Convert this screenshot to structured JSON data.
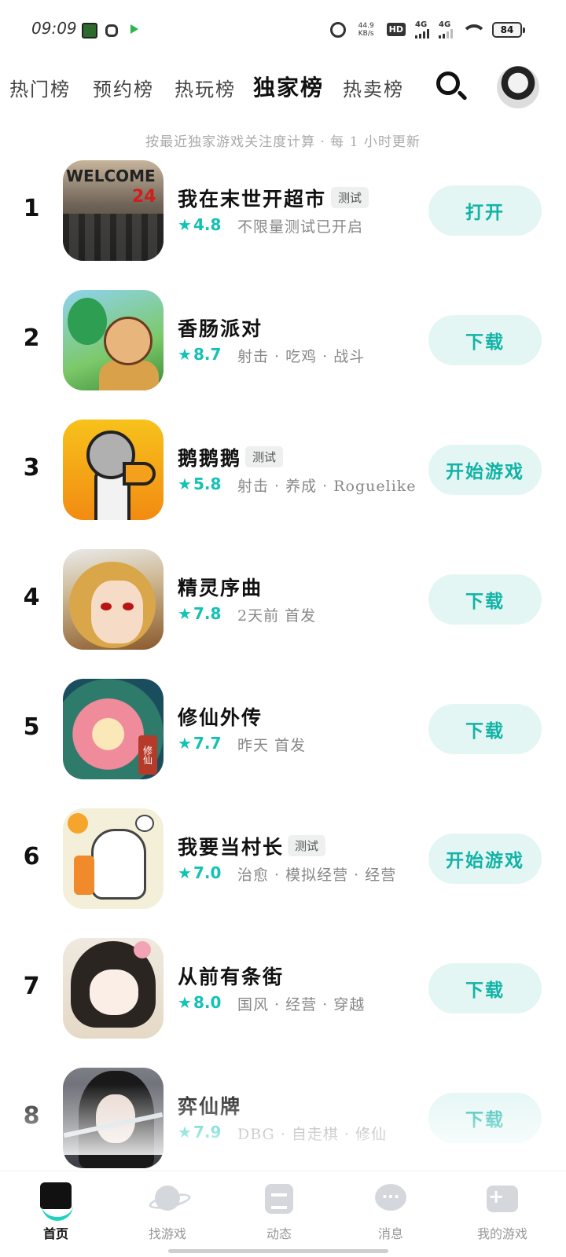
{
  "status_bar": {
    "time": "09:09",
    "net_speed_value": "44.9",
    "net_speed_unit": "KB/s",
    "hd_label": "HD",
    "sim1": "4G",
    "sim2": "4G",
    "battery": "84",
    "icons": [
      "app-icon-green",
      "app-icon-flower",
      "app-icon-play",
      "alarm-icon",
      "signal-icon",
      "wifi-icon",
      "battery-icon"
    ]
  },
  "tabs": [
    {
      "label": "热门榜",
      "active": false
    },
    {
      "label": "预约榜",
      "active": false
    },
    {
      "label": "热玩榜",
      "active": false
    },
    {
      "label": "独家榜",
      "active": true
    },
    {
      "label": "热卖榜",
      "active": false
    }
  ],
  "subtitle": "按最近独家游戏关注度计算 · 每 1 小时更新",
  "icon_art_text": {
    "game1_welcome": "WELCOME",
    "game1_number": "24",
    "game5_seal": "修仙"
  },
  "games": [
    {
      "rank": "1",
      "name": "我在末世开超市",
      "tag": "测试",
      "rating": "4.8",
      "info": "不限量测试已开启",
      "button": "打开"
    },
    {
      "rank": "2",
      "name": "香肠派对",
      "tag": "",
      "rating": "8.7",
      "info": "射击 · 吃鸡 · 战斗",
      "button": "下载"
    },
    {
      "rank": "3",
      "name": "鹅鹅鹅",
      "tag": "测试",
      "rating": "5.8",
      "info": "射击 · 养成 · Roguelike",
      "button": "开始游戏"
    },
    {
      "rank": "4",
      "name": "精灵序曲",
      "tag": "",
      "rating": "7.8",
      "info": "2天前 首发",
      "button": "下载"
    },
    {
      "rank": "5",
      "name": "修仙外传",
      "tag": "",
      "rating": "7.7",
      "info": "昨天 首发",
      "button": "下载"
    },
    {
      "rank": "6",
      "name": "我要当村长",
      "tag": "测试",
      "rating": "7.0",
      "info": "治愈 · 模拟经营 · 经营",
      "button": "开始游戏"
    },
    {
      "rank": "7",
      "name": "从前有条街",
      "tag": "",
      "rating": "8.0",
      "info": "国风 · 经营 · 穿越",
      "button": "下载"
    },
    {
      "rank": "8",
      "name": "弈仙牌",
      "tag": "",
      "rating": "7.9",
      "info": "DBG · 自走棋 · 修仙",
      "button": "下载"
    }
  ],
  "bottom_nav": [
    {
      "label": "首页",
      "icon": "home-icon",
      "active": true
    },
    {
      "label": "找游戏",
      "icon": "planet-icon",
      "active": false
    },
    {
      "label": "动态",
      "icon": "feed-icon",
      "active": false
    },
    {
      "label": "消息",
      "icon": "message-icon",
      "active": false
    },
    {
      "label": "我的游戏",
      "icon": "my-games-icon",
      "active": false
    }
  ],
  "colors": {
    "accent": "#12c2b4",
    "accent_highlight": "#1ed1c1",
    "button_bg": "#e3f6f4"
  }
}
